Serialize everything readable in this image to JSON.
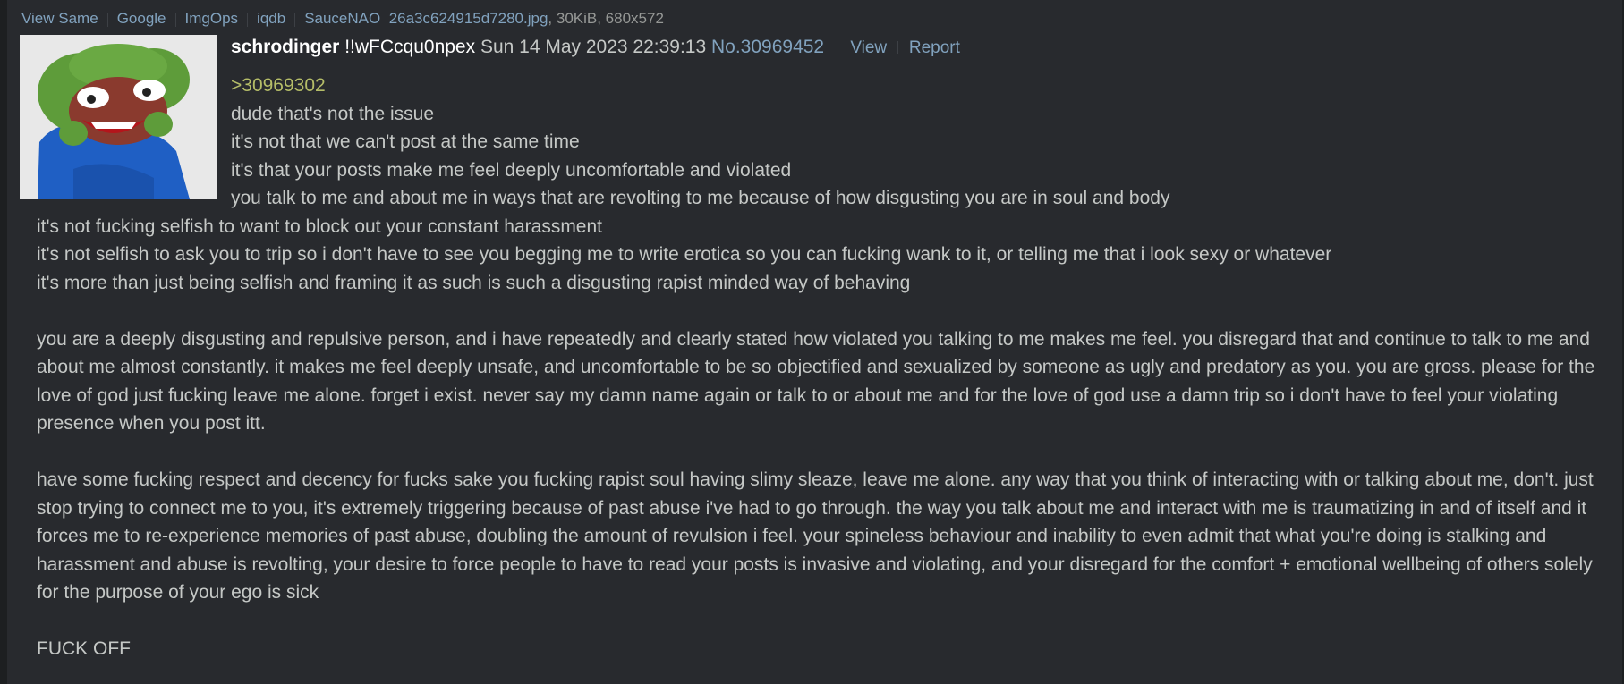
{
  "file_bar": {
    "links": [
      "View Same",
      "Google",
      "ImgOps",
      "iqdb",
      "SauceNAO"
    ],
    "filename": "26a3c624915d7280.jpg",
    "filemeta": ", 30KiB, 680x572"
  },
  "post": {
    "name": "schrodinger",
    "tripcode": "!!wFCcqu0npex",
    "datetime": "Sun 14 May 2023 22:39:13",
    "post_number": "No.30969452",
    "view_label": "View",
    "report_label": "Report",
    "thumbnail_icon": "pepe-frog-image",
    "quote_link": ">30969302",
    "wrapped_lines": [
      "dude that's not the issue",
      "it's not that we can't post at the same time",
      "it's that your posts make me feel deeply uncomfortable and violated",
      "you talk to me and about me in ways that are revolting to me because of how disgusting you are in soul and body"
    ],
    "full_lines": [
      "it's not fucking selfish to want to block out your constant harassment",
      "it's not selfish to ask you to trip so i don't have to see you begging me to write erotica so you can fucking wank to it, or telling me that i look sexy or whatever",
      "it's more than just being selfish and framing it as such is such a disgusting rapist minded way of behaving"
    ],
    "paragraph_1": "you are a deeply disgusting and repulsive person, and i have repeatedly and clearly stated how violated you talking to me makes me feel. you disregard that and continue to talk to me and about me almost constantly. it makes me feel deeply unsafe, and uncomfortable to be so objectified and sexualized by someone as ugly and predatory as you. you are gross. please for the love of god just fucking leave me alone. forget i exist. never say my damn name again or talk to or about me and for the love of god use a damn trip so i don't have to feel your violating presence when you post itt.",
    "paragraph_2": "have some fucking respect and decency for fucks sake you fucking rapist soul having slimy sleaze, leave me alone. any way that you think of interacting with or talking about me, don't. just stop trying to connect me to you, it's extremely triggering because of past abuse i've had to go through. the way you talk about me and interact with me is traumatizing in and of itself and it forces me to re-experience memories of past abuse, doubling the amount of revulsion i feel. your spineless behaviour and inability to even admit that what you're doing is stalking and harassment and abuse is revolting, your desire to force people to have to read your posts is invasive and violating, and your disregard for the comfort + emotional wellbeing of others solely for the purpose of your ego is sick",
    "closing": "FUCK OFF"
  },
  "colors": {
    "page_bg": "#1d1f21",
    "post_bg": "#282a2e",
    "text": "#c5c8c6",
    "link": "#81a2be",
    "quote": "#b5bd68",
    "name": "#ffffff"
  }
}
